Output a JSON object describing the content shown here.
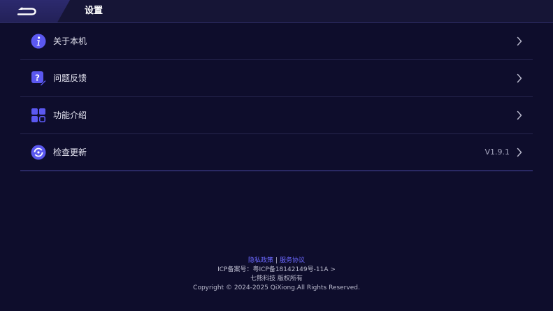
{
  "header": {
    "title": "设置",
    "back_icon": "back-arrow-icon"
  },
  "menu": {
    "items": [
      {
        "label": "关于本机",
        "icon": "info-icon"
      },
      {
        "label": "问题反馈",
        "icon": "feedback-icon"
      },
      {
        "label": "功能介绍",
        "icon": "features-grid-icon"
      },
      {
        "label": "检查更新",
        "icon": "update-icon",
        "value": "V1.9.1"
      }
    ]
  },
  "footer": {
    "privacy_label": "隐私政策",
    "separator": "|",
    "terms_label": "服务协议",
    "icp_text": "ICP备案号：粤ICP备18142149号-11A >",
    "company_text": "七熊科技 版权所有",
    "copyright_text": "Copyright © 2024-2025 QiXiong.All Rights Reserved."
  },
  "colors": {
    "background": "#0e0d2c",
    "accent": "#6b68ff",
    "icon": "#5b58f0"
  }
}
